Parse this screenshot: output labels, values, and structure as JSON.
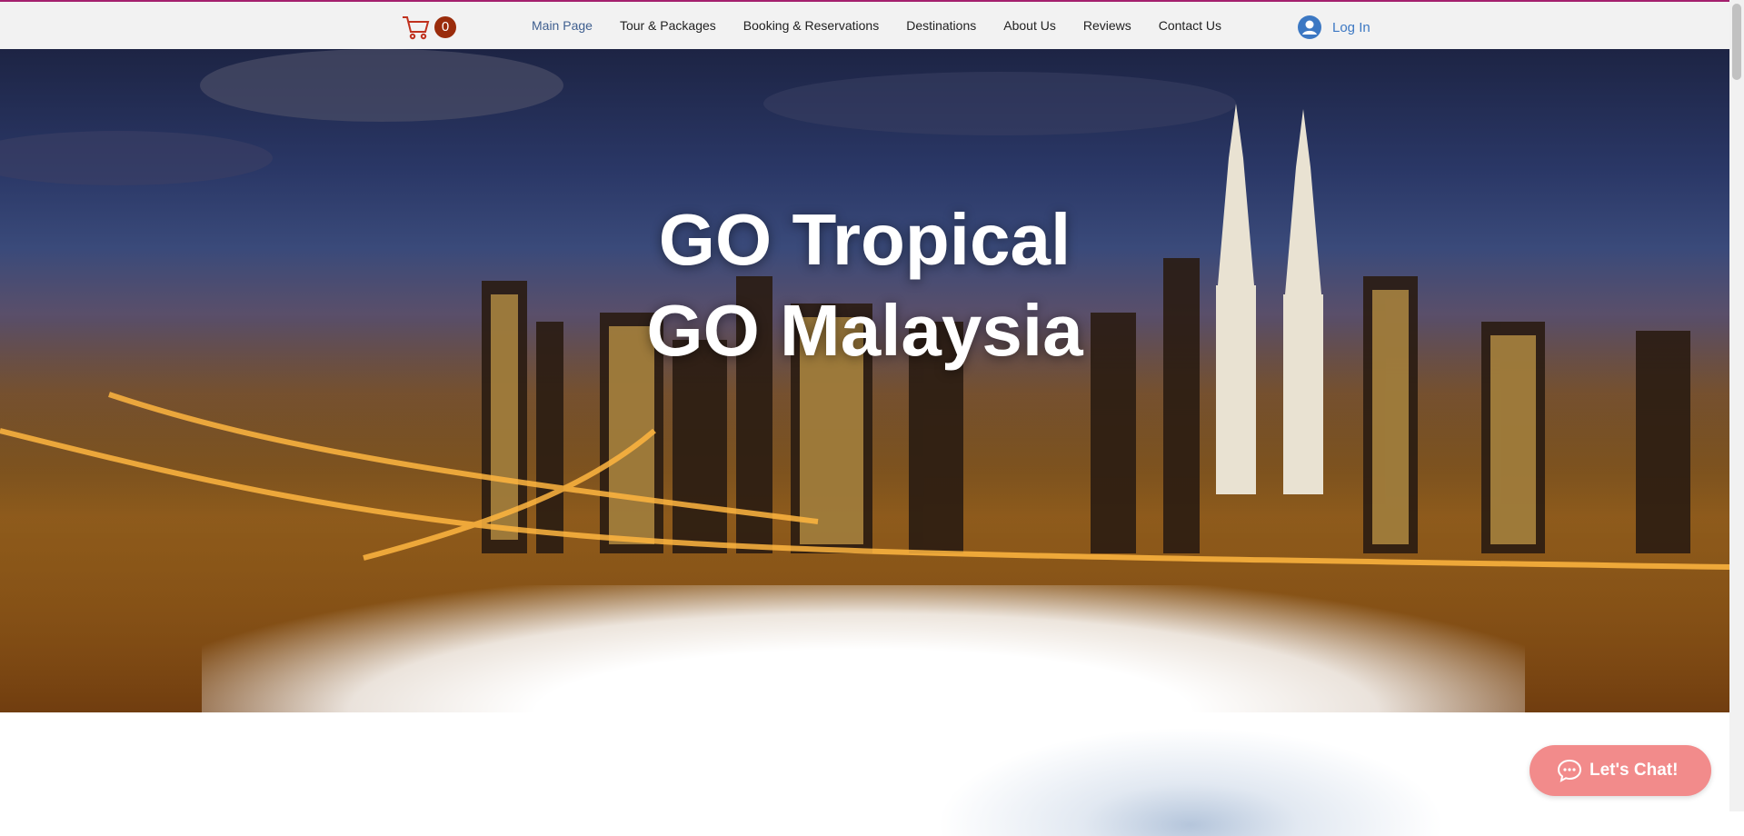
{
  "header": {
    "cart_count": "0",
    "nav": [
      {
        "label": "Main Page",
        "active": true
      },
      {
        "label": "Tour & Packages"
      },
      {
        "label": "Booking & Reservations"
      },
      {
        "label": "Destinations"
      },
      {
        "label": "About Us"
      },
      {
        "label": "Reviews"
      },
      {
        "label": "Contact Us"
      }
    ],
    "login_label": "Log In"
  },
  "hero": {
    "title_line1": "GO Tropical",
    "title_line2": "GO Malaysia"
  },
  "chat": {
    "label": "Let's Chat!"
  },
  "icons": [
    "cart-icon",
    "user-avatar-icon",
    "chat-bubble-icon"
  ],
  "colors": {
    "accent_line": "#a4206e",
    "cart_badge": "#9a2c0c",
    "login_text": "#3c78c3",
    "chat_button": "#f28b8b",
    "nav_active": "#3f5f8f"
  }
}
